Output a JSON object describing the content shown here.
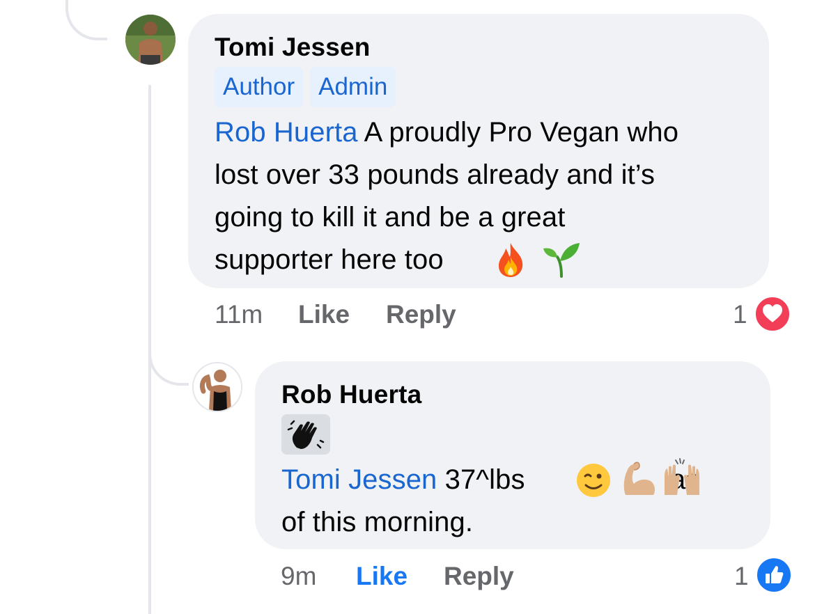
{
  "comment": {
    "author": "Tomi Jessen",
    "badges": [
      "Author",
      "Admin"
    ],
    "mention": "Rob Huerta",
    "lines": [
      " A proudly Pro Vegan who",
      "lost over 33 pounds already and it’s",
      "going to kill it and be a great",
      "supporter here too "
    ],
    "emojis": [
      "fire-icon",
      "seedling-icon"
    ],
    "time": "11m",
    "like_label": "Like",
    "reply_label": "Reply",
    "reaction_count": "1",
    "reaction_type": "heart-icon"
  },
  "reply": {
    "author": "Rob Huerta",
    "badge_icon": "waving-hand-icon",
    "mention": "Tomi Jessen",
    "line1_text": " 37^lbs ",
    "line1_tail": " as",
    "line2": "of this morning.",
    "emojis": [
      "winking-face-icon",
      "flexed-biceps-icon",
      "raising-hands-icon"
    ],
    "time": "9m",
    "like_label": "Like",
    "like_active": true,
    "reply_label": "Reply",
    "reaction_count": "1",
    "reaction_type": "thumbs-up-icon"
  },
  "colors": {
    "bubble": "#f0f2f5",
    "link": "#1a66d1",
    "meta": "#65676b",
    "like_active": "#1877f2",
    "heart": "#f33e58",
    "thread_line": "#e4e6eb"
  }
}
